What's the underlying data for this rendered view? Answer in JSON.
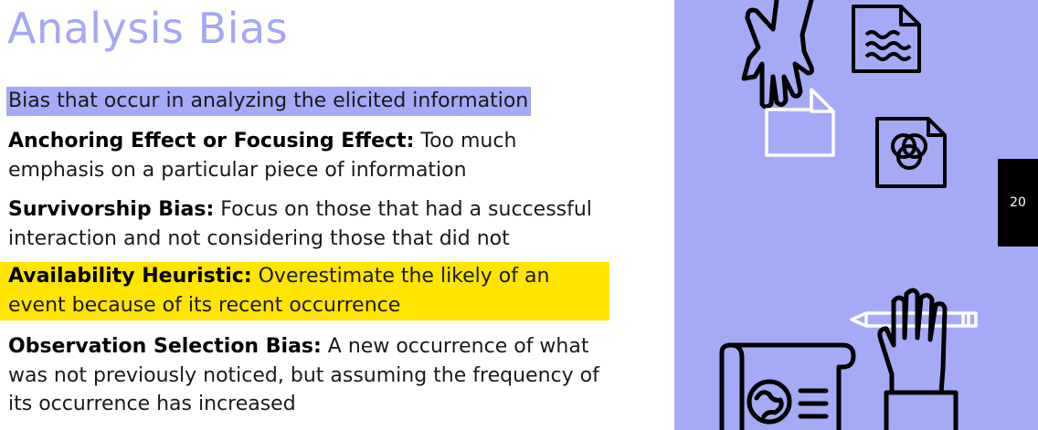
{
  "slide": {
    "title": "Analysis Bias",
    "intro": "Bias that occur in analyzing the elicited information",
    "items": [
      {
        "term": "Anchoring Effect or Focusing Effect:",
        "description": " Too much emphasis on a particular piece of information"
      },
      {
        "term": "Survivorship Bias:",
        "description": " Focus on those that had a successful interaction and not considering those that did not"
      },
      {
        "term": "Availability Heuristic:",
        "description": " Overestimate the likely of an event because of its recent occurrence"
      },
      {
        "term": "Observation Selection Bias:",
        "description": " A new occurrence of what was not previously noticed, but assuming the frequency of its occurrence has increased"
      }
    ],
    "page_number": "20"
  },
  "colors": {
    "title": "#a2a8f4",
    "intro_highlight": "#a4aaf5",
    "availability_highlight": "#ffe500",
    "side_panel": "#a4aaf5",
    "page_tab": "#000000"
  },
  "icons": [
    "hand-icon",
    "document-wave-icon",
    "blank-document-icon",
    "venn-document-icon",
    "pencil-icon",
    "raised-hand-icon",
    "scroll-globe-icon"
  ]
}
